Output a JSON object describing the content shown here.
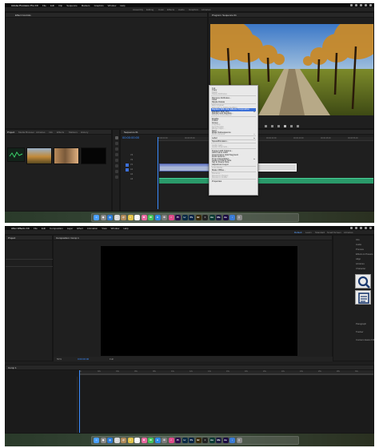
{
  "top": {
    "menubar": {
      "app": "Adobe Premiere Pro CC",
      "items": [
        "File",
        "Edit",
        "Clip",
        "Sequence",
        "Markers",
        "Graphics",
        "Window",
        "Help"
      ]
    },
    "workspaces": [
      "Assembly",
      "Editing",
      "Color",
      "Effects",
      "Audio",
      "Graphics",
      "Libraries"
    ],
    "source_tab": "Effect Controls",
    "program_tab": "Program: Sequence 01",
    "project_tabs": [
      "Project",
      "Media Browser",
      "Libraries",
      "Info",
      "Effects",
      "Markers",
      "History"
    ],
    "project_items": [
      "",
      "",
      "",
      ""
    ],
    "timeline_tab": "Sequence 01",
    "timecode": "00:00:00:00",
    "ruler": [
      "00:00:00:00",
      "00:00:08:00",
      "00:00:16:00",
      "00:00:24:00",
      "00:00:32:00",
      "00:00:40:00",
      "00:00:48:00",
      "00:00:56:00"
    ],
    "tracks": [
      "V3",
      "V2",
      "V1",
      "A1",
      "A2",
      "A3"
    ],
    "context_menu": [
      {
        "label": "Cut",
        "state": "normal"
      },
      {
        "label": "Copy",
        "state": "normal"
      },
      {
        "label": "Paste",
        "state": "disabled"
      },
      {
        "label": "Paste Attributes",
        "state": "disabled"
      },
      {
        "sep": true
      },
      {
        "label": "Remove Attributes...",
        "state": "normal"
      },
      {
        "label": "Clear",
        "state": "normal"
      },
      {
        "label": "Ripple Delete",
        "state": "normal"
      },
      {
        "sep": true
      },
      {
        "label": "Edit Original",
        "state": "disabled"
      },
      {
        "label": "Edit Clip in Adobe Audition",
        "state": "disabled"
      },
      {
        "label": "Replace With After Effects Composition",
        "state": "highlighted"
      },
      {
        "label": "Replace With Clip",
        "state": "normal",
        "sub": true
      },
      {
        "label": "Render and Replace...",
        "state": "normal"
      },
      {
        "label": "Restore Unrendered",
        "state": "disabled"
      },
      {
        "sep": true
      },
      {
        "label": "Enable",
        "state": "normal"
      },
      {
        "label": "Unlink",
        "state": "normal"
      },
      {
        "label": "Group",
        "state": "normal"
      },
      {
        "label": "Ungroup",
        "state": "disabled"
      },
      {
        "label": "Synchronize",
        "state": "disabled"
      },
      {
        "label": "Merge Clips...",
        "state": "disabled"
      },
      {
        "label": "Nest...",
        "state": "normal"
      },
      {
        "label": "Make Subsequence",
        "state": "normal"
      },
      {
        "label": "Multi-Camera",
        "state": "disabled",
        "sub": true
      },
      {
        "sep": true
      },
      {
        "label": "Label",
        "state": "normal",
        "sub": true
      },
      {
        "sep": true
      },
      {
        "label": "Speed/Duration...",
        "state": "normal"
      },
      {
        "sep": true
      },
      {
        "label": "Audio Gain...",
        "state": "disabled"
      },
      {
        "label": "Audio Channels...",
        "state": "disabled"
      },
      {
        "sep": true
      },
      {
        "label": "Frame Hold Options...",
        "state": "normal"
      },
      {
        "label": "Add Frame Hold",
        "state": "normal"
      },
      {
        "label": "Insert Frame Hold Segment",
        "state": "normal"
      },
      {
        "label": "Field Options...",
        "state": "normal"
      },
      {
        "label": "Time Interpolation",
        "state": "normal",
        "sub": true
      },
      {
        "label": "Scale to Frame Size",
        "state": "normal"
      },
      {
        "label": "Set to Frame Size",
        "state": "normal"
      },
      {
        "label": "Adjustment Layer",
        "state": "normal"
      },
      {
        "sep": true
      },
      {
        "label": "Link Media...",
        "state": "disabled"
      },
      {
        "label": "Make Offline...",
        "state": "normal"
      },
      {
        "sep": true
      },
      {
        "label": "Rename...",
        "state": "disabled"
      },
      {
        "label": "Reveal in Project",
        "state": "disabled"
      },
      {
        "label": "Reveal in Finder...",
        "state": "disabled"
      },
      {
        "sep": true
      },
      {
        "label": "Properties",
        "state": "normal"
      }
    ]
  },
  "bottom": {
    "menubar": {
      "app": "After Effects CC",
      "items": [
        "File",
        "Edit",
        "Composition",
        "Layer",
        "Effect",
        "Animation",
        "View",
        "Window",
        "Help"
      ]
    },
    "workspaces": [
      "Default",
      "Learn",
      "Standard",
      "Small Screen",
      "Libraries"
    ],
    "comp_tab": "Composition: Comp 1",
    "project_tab": "Project",
    "right_panel": [
      "Info",
      "Audio",
      "Preview",
      "Effects & Presets",
      "Align",
      "Libraries",
      "Character",
      "Paragraph",
      "Tracker",
      "Content-Aware Fill"
    ],
    "zoom": "50%",
    "timecode": "0:00:00:00",
    "resolution": "Full",
    "timeline_tab": "Comp 1",
    "ruler": [
      "0s",
      "02s",
      "04s",
      "06s",
      "08s",
      "10s",
      "12s",
      "14s",
      "16s",
      "18s",
      "20s",
      "22s",
      "24s",
      "26s",
      "28s",
      "30s"
    ]
  },
  "dock_icons": [
    {
      "name": "finder-icon",
      "color": "#4aa0ff",
      "glyph": "☺"
    },
    {
      "name": "launchpad-icon",
      "color": "#8a8a8a",
      "glyph": "◉"
    },
    {
      "name": "safari-icon",
      "color": "#2b7bd6",
      "glyph": "◎"
    },
    {
      "name": "chrome-icon",
      "color": "#d9d9d9",
      "glyph": "●"
    },
    {
      "name": "contacts-icon",
      "color": "#b08a5a",
      "glyph": "@"
    },
    {
      "name": "notes-icon",
      "color": "#e0c24a",
      "glyph": "≡"
    },
    {
      "name": "calendar-icon",
      "color": "#f2f2f2",
      "glyph": "▦"
    },
    {
      "name": "photos-icon",
      "color": "#e86aa0",
      "glyph": "✿"
    },
    {
      "name": "messages-icon",
      "color": "#45c45a",
      "glyph": "✉"
    },
    {
      "name": "appstore-icon",
      "color": "#2d8ae8",
      "glyph": "A"
    },
    {
      "name": "settings-icon",
      "color": "#7b7b7b",
      "glyph": "⚙"
    },
    {
      "name": "itunes-icon",
      "color": "#e04a8a",
      "glyph": "♫"
    },
    {
      "name": "premiere-icon",
      "color": "#2a0a4a",
      "glyph": "Pr"
    },
    {
      "name": "lightroom-icon",
      "color": "#0a2a44",
      "glyph": "Lr"
    },
    {
      "name": "photoshop-icon",
      "color": "#0a2444",
      "glyph": "Ps"
    },
    {
      "name": "bridge-icon",
      "color": "#3a2a0a",
      "glyph": "Br"
    },
    {
      "name": "terminal-icon",
      "color": "#222",
      "glyph": ">"
    },
    {
      "name": "audition-icon",
      "color": "#0a3a33",
      "glyph": "Au"
    },
    {
      "name": "media-encoder-icon",
      "color": "#1a1a40",
      "glyph": "Me"
    },
    {
      "name": "aftereffects-icon",
      "color": "#1a0a40",
      "glyph": "Ae"
    },
    {
      "name": "downloads-icon",
      "color": "#3a7bd5",
      "glyph": "↓"
    },
    {
      "name": "trash-icon",
      "color": "#8a8a8a",
      "glyph": "▯"
    }
  ]
}
